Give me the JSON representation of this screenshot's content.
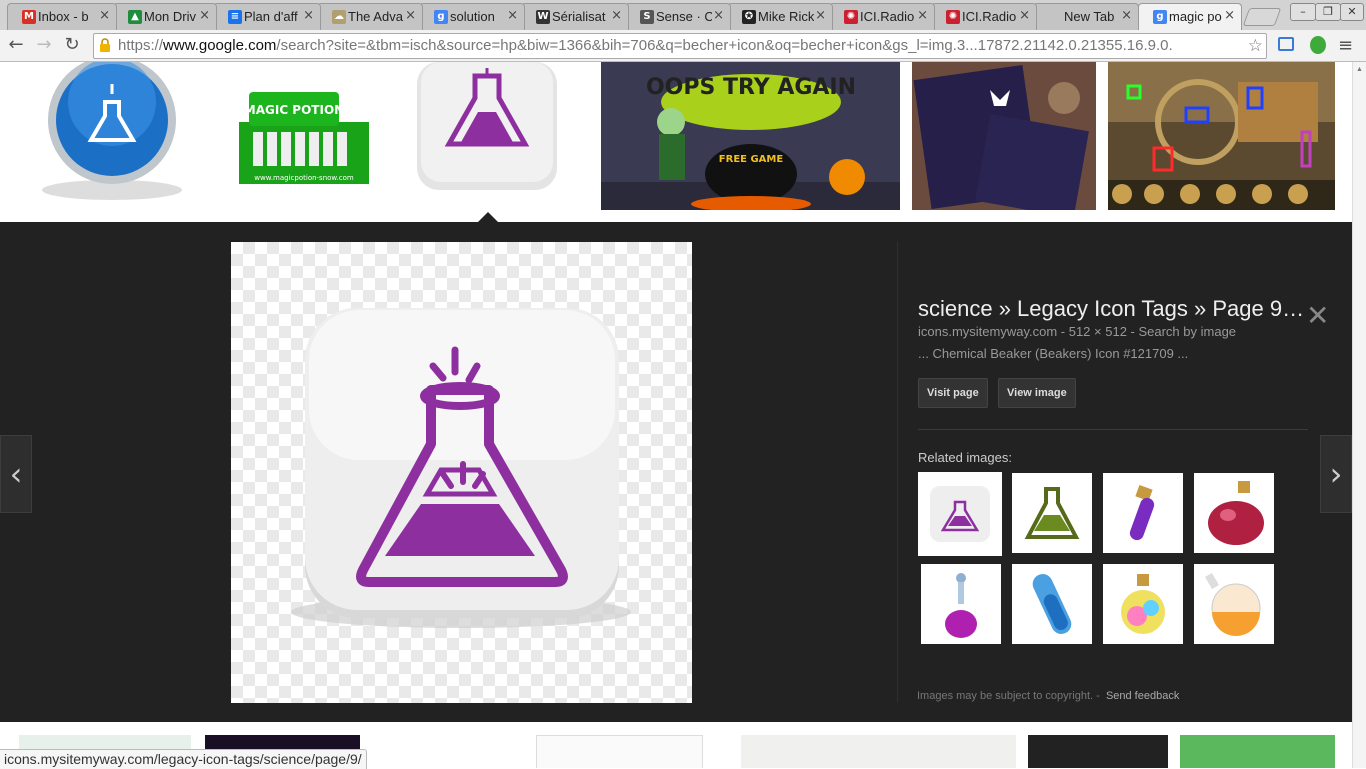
{
  "tabs": [
    {
      "title": "Inbox - b",
      "icon": "gmail-icon",
      "color": "#d93025",
      "glyph": "M"
    },
    {
      "title": "Mon Driv",
      "icon": "drive-icon",
      "color": "#1e8e3e",
      "glyph": "▲"
    },
    {
      "title": "Plan d'aff",
      "icon": "docs-icon",
      "color": "#1a73e8",
      "glyph": "≡"
    },
    {
      "title": "The Adva",
      "icon": "cloud-icon",
      "color": "#b0a070",
      "glyph": "☁"
    },
    {
      "title": "solution",
      "icon": "google-icon",
      "color": "#4285f4",
      "glyph": "g"
    },
    {
      "title": "Sérialisat",
      "icon": "wikipedia-icon",
      "color": "#333333",
      "glyph": "W"
    },
    {
      "title": "Sense · C",
      "icon": "sense-icon",
      "color": "#555555",
      "glyph": "S"
    },
    {
      "title": "Mike Rick",
      "icon": "nhl-icon",
      "color": "#222222",
      "glyph": "✪"
    },
    {
      "title": "ICI.Radio",
      "icon": "radio-canada-icon",
      "color": "#cc1f2f",
      "glyph": "✺"
    },
    {
      "title": "ICI.Radio",
      "icon": "radio-canada-icon",
      "color": "#cc1f2f",
      "glyph": "✺"
    },
    {
      "title": "New Tab",
      "icon": "none",
      "color": "#cccccc",
      "glyph": ""
    },
    {
      "title": "magic po",
      "icon": "google-icon",
      "color": "#4285f4",
      "glyph": "g"
    }
  ],
  "url": {
    "prefix": "https://",
    "host": "www.google.com",
    "rest": "/search?site=&tbm=isch&source=hp&biw=1366&bih=706&q=becher+icon&oq=becher+icon&gs_l=img.3...17872.21142.0.21355.16.9.0."
  },
  "detail": {
    "title": "science » Legacy Icon Tags » Page 9…",
    "meta": "icons.mysitemyway.com - 512 × 512 - Search by image",
    "desc": "... Chemical Beaker (Beakers) Icon #121709 ...",
    "visit_label": "Visit page",
    "view_label": "View image",
    "related_label": "Related images:",
    "copyright": "Images may be subject to copyright.",
    "feedback": "Send feedback"
  },
  "thumb_text": {
    "magic_potion": "MAGIC POTION",
    "magic_potion_url": "www.magicpotion-snow.com",
    "oops": "OOPS TRY AGAIN",
    "free_game": "FREE GAME"
  },
  "status_url": "icons.mysitemyway.com/legacy-icon-tags/science/page/9/",
  "colors": {
    "accent_purple": "#8e2fa0",
    "panel_bg": "#222222"
  }
}
